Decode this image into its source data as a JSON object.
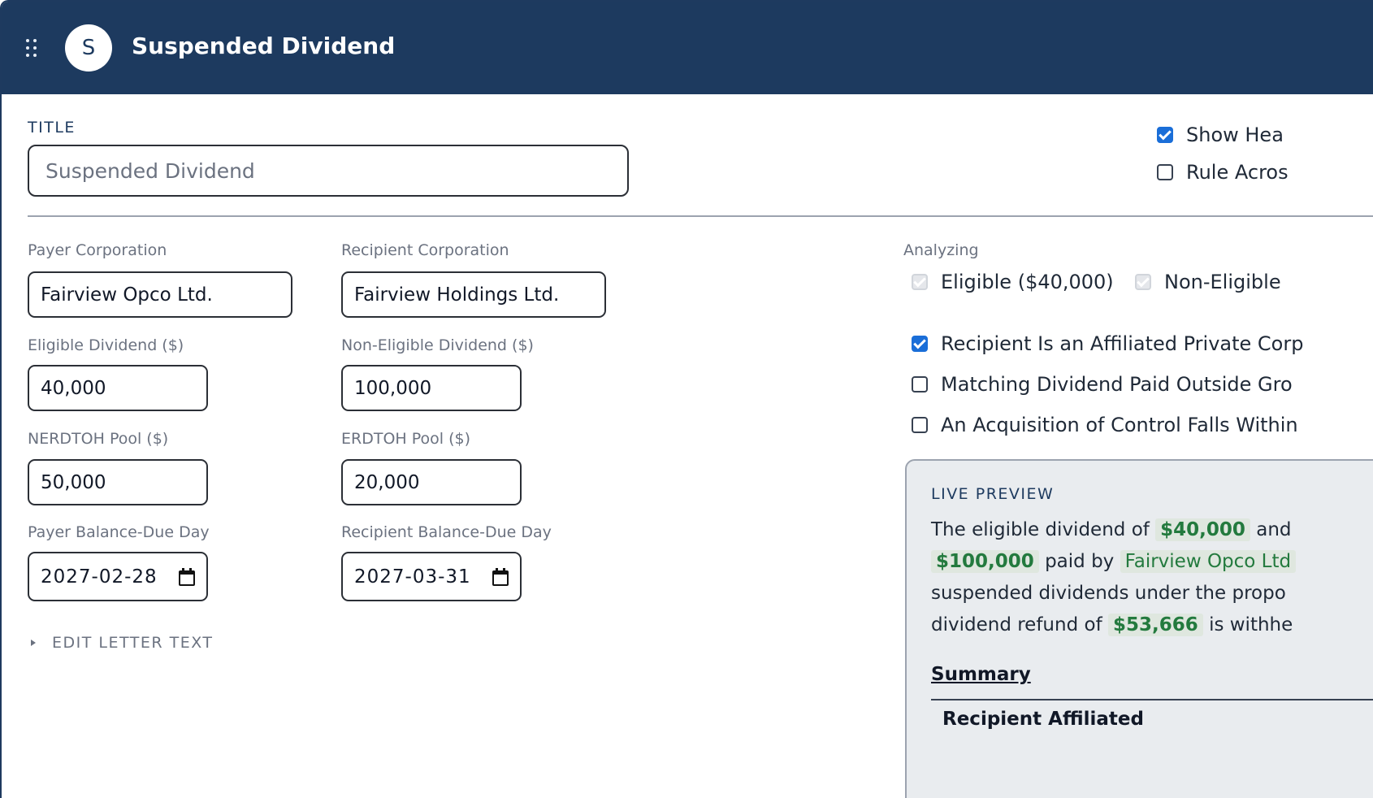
{
  "app": {
    "title": "Suspended Dividend",
    "avatar_letter": "S"
  },
  "title_section": {
    "label": "TITLE",
    "placeholder": "Suspended Dividend"
  },
  "options": {
    "show_header": "Show Hea",
    "rule_across": "Rule Acros"
  },
  "form": {
    "payer_corporation_label": "Payer Corporation",
    "payer_corporation_value": "Fairview Opco Ltd.",
    "recipient_corporation_label": "Recipient Corporation",
    "recipient_corporation_value": "Fairview Holdings Ltd.",
    "eligible_dividend_label": "Eligible Dividend ($)",
    "eligible_dividend_value": "40,000",
    "non_eligible_dividend_label": "Non-Eligible Dividend ($)",
    "non_eligible_dividend_value": "100,000",
    "nerdtoh_label": "NERDTOH Pool ($)",
    "nerdtoh_value": "50,000",
    "erdtoh_label": "ERDTOH Pool ($)",
    "erdtoh_value": "20,000",
    "payer_due_label": "Payer Balance-Due Day",
    "payer_due_value": "2027-02-28",
    "recipient_due_label": "Recipient Balance-Due Day",
    "recipient_due_value": "2027-03-31"
  },
  "edit_letter": {
    "label": "EDIT LETTER TEXT"
  },
  "analyzing": {
    "label": "Analyzing",
    "eligible": "Eligible ($40,000)",
    "non_eligible": "Non-Eligible"
  },
  "conditions": {
    "affiliated": "Recipient Is an Affiliated Private Corp",
    "matching": "Matching Dividend Paid Outside Gro",
    "acquisition": "An Acquisition of Control Falls Within"
  },
  "preview": {
    "label": "LIVE PREVIEW",
    "t1": "The eligible dividend of",
    "v1": "$40,000",
    "t2": "and",
    "v2": "$100,000",
    "t3": "paid by",
    "v3": "Fairview Opco Ltd",
    "t4": "suspended dividends under the propo",
    "t5": "dividend refund of",
    "v4": "$53,666",
    "t6": "is withhe",
    "summary_title": "Summary",
    "summary_row": "Recipient Affiliated"
  }
}
